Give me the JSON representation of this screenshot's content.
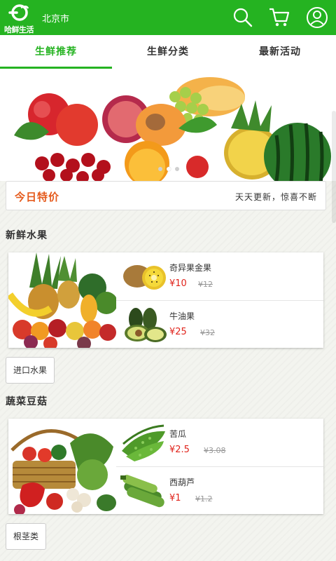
{
  "header": {
    "logo_text": "哈鲜生活",
    "city": "北京市",
    "icons": [
      "search-icon",
      "cart-icon",
      "user-icon"
    ],
    "bg_color": "#25b321"
  },
  "tabs": [
    {
      "label": "生鲜推荐",
      "active": true
    },
    {
      "label": "生鲜分类",
      "active": false
    },
    {
      "label": "最新活动",
      "active": false
    }
  ],
  "banner": {
    "slide_index": 1,
    "slide_count": 3
  },
  "today_special": {
    "title": "今日特价",
    "subtitle": "天天更新，惊喜不断",
    "title_color": "#e55a1c"
  },
  "sections": [
    {
      "title": "新鲜水果",
      "products": [
        {
          "name": "奇异果金果",
          "price": "¥10",
          "old_price": "¥12"
        },
        {
          "name": "牛油果",
          "price": "¥25",
          "old_price": "¥32"
        }
      ],
      "more_chip": "进口水果"
    },
    {
      "title": "蔬菜豆菇",
      "products": [
        {
          "name": "苦瓜",
          "price": "¥2.5",
          "old_price": "¥3.08"
        },
        {
          "name": "西葫芦",
          "price": "¥1",
          "old_price": "¥1.2"
        }
      ],
      "more_chip": "根茎类"
    }
  ],
  "colors": {
    "accent": "#25b321",
    "price": "#e0241c"
  }
}
